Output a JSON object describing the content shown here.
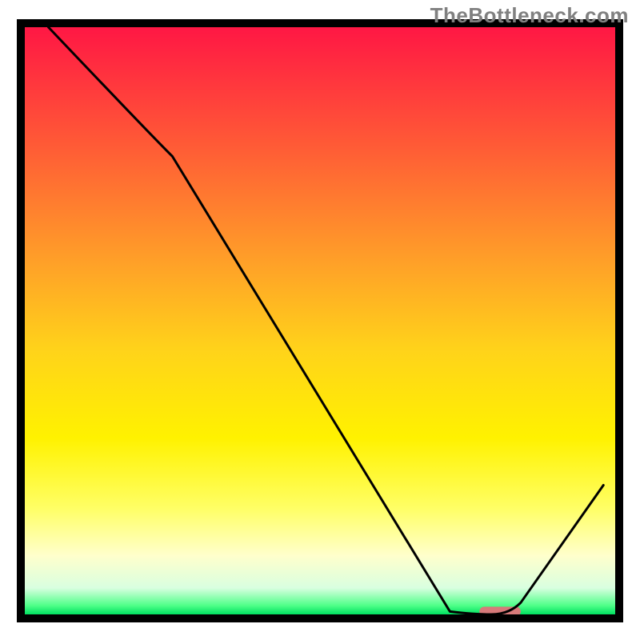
{
  "attribution": "TheBottleneck.com",
  "chart_data": {
    "type": "line",
    "title": "",
    "xlabel": "",
    "ylabel": "",
    "xlim": [
      0,
      100
    ],
    "ylim": [
      0,
      100
    ],
    "x": [
      4,
      25,
      72,
      79,
      84,
      98
    ],
    "values": [
      100,
      78,
      0.5,
      0,
      2,
      22
    ],
    "marker": {
      "x_start": 77,
      "x_end": 84,
      "y": 0.5,
      "color": "#d77a7a"
    },
    "gradient_stops": [
      {
        "offset": 0.0,
        "color": "#ff1744"
      },
      {
        "offset": 0.2,
        "color": "#ff5a36"
      },
      {
        "offset": 0.4,
        "color": "#ffa028"
      },
      {
        "offset": 0.55,
        "color": "#ffd31a"
      },
      {
        "offset": 0.7,
        "color": "#fff200"
      },
      {
        "offset": 0.82,
        "color": "#ffff66"
      },
      {
        "offset": 0.9,
        "color": "#ffffcc"
      },
      {
        "offset": 0.955,
        "color": "#d9ffe0"
      },
      {
        "offset": 0.985,
        "color": "#4eff88"
      },
      {
        "offset": 1.0,
        "color": "#00e060"
      }
    ],
    "frame_color": "#000000",
    "line_color": "#000000"
  }
}
